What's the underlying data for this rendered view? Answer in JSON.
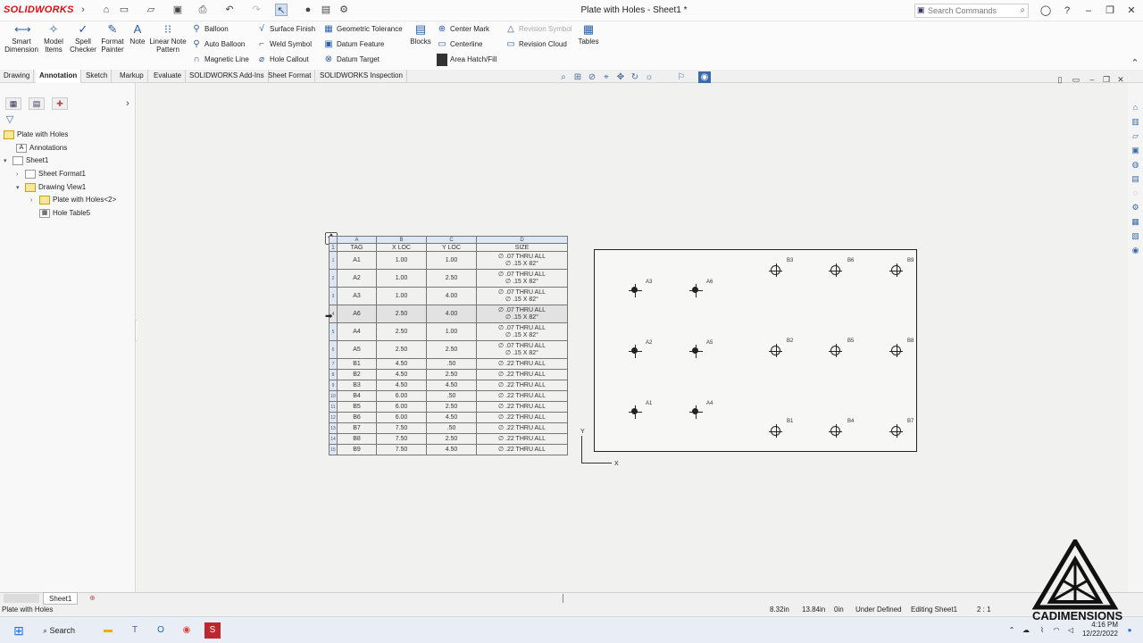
{
  "app": {
    "logo_text": "SOLIDWORKS",
    "doc_title": "Plate with Holes - Sheet1 *",
    "search_placeholder": "Search Commands"
  },
  "commands": {
    "smart_dimension": "Smart Dimension",
    "model_items": "Model Items",
    "spell_checker": "Spell Checker",
    "format_painter": "Format Painter",
    "note": "Note",
    "linear_note_pattern": "Linear Note Pattern",
    "balloon": "Balloon",
    "auto_balloon": "Auto Balloon",
    "magnetic_line": "Magnetic Line",
    "surface_finish": "Surface Finish",
    "weld_symbol": "Weld Symbol",
    "hole_callout": "Hole Callout",
    "geometric_tolerance": "Geometric Tolerance",
    "datum_feature": "Datum Feature",
    "datum_target": "Datum Target",
    "blocks": "Blocks",
    "center_mark": "Center Mark",
    "centerline": "Centerline",
    "area_hatch": "Area Hatch/Fill",
    "revision_symbol": "Revision Symbol",
    "revision_cloud": "Revision Cloud",
    "tables": "Tables"
  },
  "tabs": [
    "Drawing",
    "Annotation",
    "Sketch",
    "Markup",
    "Evaluate",
    "SOLIDWORKS Add-Ins",
    "Sheet Format",
    "SOLIDWORKS Inspection"
  ],
  "active_tab": "Annotation",
  "tree": {
    "root": "Plate with Holes",
    "annotations": "Annotations",
    "sheet": "Sheet1",
    "sheet_format": "Sheet Format1",
    "drawing_view": "Drawing View1",
    "part": "Plate with Holes<2>",
    "hole_table": "Hole Table5"
  },
  "hole_table": {
    "col_letters": [
      "A",
      "B",
      "C",
      "D"
    ],
    "headers": [
      "TAG",
      "X LOC",
      "Y LOC",
      "SIZE"
    ],
    "rows": [
      {
        "n": "1",
        "tag": "A1",
        "x": "1.00",
        "y": "1.00",
        "s1": "∅ .07 THRU ALL",
        "s2": "∅ .15 X 82°"
      },
      {
        "n": "2",
        "tag": "A2",
        "x": "1.00",
        "y": "2.50",
        "s1": "∅ .07 THRU ALL",
        "s2": "∅ .15 X 82°"
      },
      {
        "n": "3",
        "tag": "A3",
        "x": "1.00",
        "y": "4.00",
        "s1": "∅ .07 THRU ALL",
        "s2": "∅ .15 X 82°"
      },
      {
        "n": "4",
        "tag": "A6",
        "x": "2.50",
        "y": "4.00",
        "s1": "∅ .07 THRU ALL",
        "s2": "∅ .15 X 82°"
      },
      {
        "n": "5",
        "tag": "A4",
        "x": "2.50",
        "y": "1.00",
        "s1": "∅ .07 THRU ALL",
        "s2": "∅ .15 X 82°"
      },
      {
        "n": "6",
        "tag": "A5",
        "x": "2.50",
        "y": "2.50",
        "s1": "∅ .07 THRU ALL",
        "s2": "∅ .15 X 82°"
      },
      {
        "n": "7",
        "tag": "B1",
        "x": "4.50",
        "y": ".50",
        "s1": "∅ .22 THRU ALL",
        "s2": ""
      },
      {
        "n": "8",
        "tag": "B2",
        "x": "4.50",
        "y": "2.50",
        "s1": "∅ .22 THRU ALL",
        "s2": ""
      },
      {
        "n": "9",
        "tag": "B3",
        "x": "4.50",
        "y": "4.50",
        "s1": "∅ .22 THRU ALL",
        "s2": ""
      },
      {
        "n": "10",
        "tag": "B4",
        "x": "6.00",
        "y": ".50",
        "s1": "∅ .22 THRU ALL",
        "s2": ""
      },
      {
        "n": "11",
        "tag": "B5",
        "x": "6.00",
        "y": "2.50",
        "s1": "∅ .22 THRU ALL",
        "s2": ""
      },
      {
        "n": "12",
        "tag": "B6",
        "x": "6.00",
        "y": "4.50",
        "s1": "∅ .22 THRU ALL",
        "s2": ""
      },
      {
        "n": "13",
        "tag": "B7",
        "x": "7.50",
        "y": ".50",
        "s1": "∅ .22 THRU ALL",
        "s2": ""
      },
      {
        "n": "14",
        "tag": "B8",
        "x": "7.50",
        "y": "2.50",
        "s1": "∅ .22 THRU ALL",
        "s2": ""
      },
      {
        "n": "15",
        "tag": "B9",
        "x": "7.50",
        "y": "4.50",
        "s1": "∅ .22 THRU ALL",
        "s2": ""
      }
    ],
    "selected_row": 3
  },
  "drawing_view": {
    "tags": {
      "A1": "A1",
      "A2": "A2",
      "A3": "A3",
      "A4": "A4",
      "A5": "A5",
      "A6": "A6",
      "B1": "B1",
      "B2": "B2",
      "B3": "B3",
      "B4": "B4",
      "B5": "B5",
      "B6": "B6",
      "B7": "B7",
      "B8": "B8",
      "B9": "B9"
    },
    "axis_x": "X",
    "axis_y": "Y"
  },
  "sheet_tab": "Sheet1",
  "status": {
    "doc": "Plate with Holes",
    "x": "8.32in",
    "y": "13.84in",
    "z": "0in",
    "state": "Under Defined",
    "editing": "Editing Sheet1",
    "scale": "2 : 1"
  },
  "taskbar": {
    "search": "Search",
    "time": "4:16 PM",
    "date": "12/22/2022"
  },
  "watermark": "CADIMENSIONS"
}
